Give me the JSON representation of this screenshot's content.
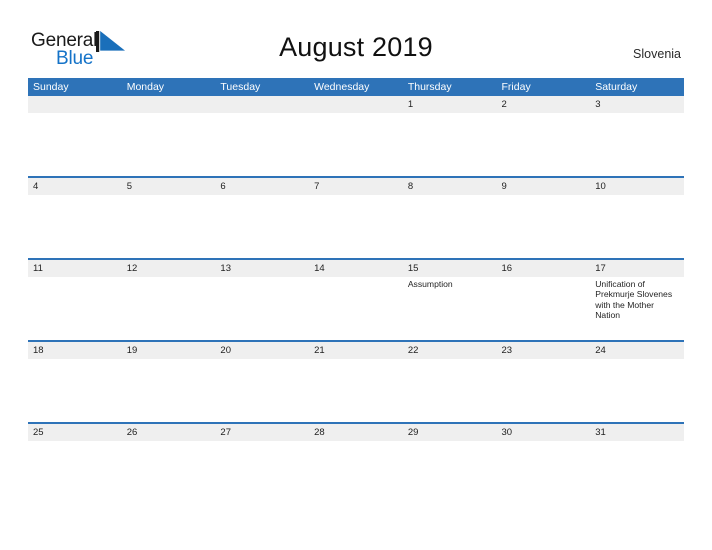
{
  "brand": {
    "name_part1": "General",
    "name_part2": "Blue",
    "mark_icon": "triangle-flag-icon",
    "accent_color": "#1573c8"
  },
  "header": {
    "title": "August 2019",
    "region": "Slovenia"
  },
  "calendar": {
    "header_color": "#2e73b8",
    "date_band_color": "#efefef",
    "weekday_headers": [
      "Sunday",
      "Monday",
      "Tuesday",
      "Wednesday",
      "Thursday",
      "Friday",
      "Saturday"
    ],
    "weeks": [
      {
        "days": [
          {
            "date": "",
            "events": []
          },
          {
            "date": "",
            "events": []
          },
          {
            "date": "",
            "events": []
          },
          {
            "date": "",
            "events": []
          },
          {
            "date": "1",
            "events": []
          },
          {
            "date": "2",
            "events": []
          },
          {
            "date": "3",
            "events": []
          }
        ]
      },
      {
        "days": [
          {
            "date": "4",
            "events": []
          },
          {
            "date": "5",
            "events": []
          },
          {
            "date": "6",
            "events": []
          },
          {
            "date": "7",
            "events": []
          },
          {
            "date": "8",
            "events": []
          },
          {
            "date": "9",
            "events": []
          },
          {
            "date": "10",
            "events": []
          }
        ]
      },
      {
        "days": [
          {
            "date": "11",
            "events": []
          },
          {
            "date": "12",
            "events": []
          },
          {
            "date": "13",
            "events": []
          },
          {
            "date": "14",
            "events": []
          },
          {
            "date": "15",
            "events": [
              "Assumption"
            ]
          },
          {
            "date": "16",
            "events": []
          },
          {
            "date": "17",
            "events": [
              "Unification of Prekmurje Slovenes with the Mother Nation"
            ]
          }
        ]
      },
      {
        "days": [
          {
            "date": "18",
            "events": []
          },
          {
            "date": "19",
            "events": []
          },
          {
            "date": "20",
            "events": []
          },
          {
            "date": "21",
            "events": []
          },
          {
            "date": "22",
            "events": []
          },
          {
            "date": "23",
            "events": []
          },
          {
            "date": "24",
            "events": []
          }
        ]
      },
      {
        "days": [
          {
            "date": "25",
            "events": []
          },
          {
            "date": "26",
            "events": []
          },
          {
            "date": "27",
            "events": []
          },
          {
            "date": "28",
            "events": []
          },
          {
            "date": "29",
            "events": []
          },
          {
            "date": "30",
            "events": []
          },
          {
            "date": "31",
            "events": []
          }
        ]
      }
    ]
  }
}
